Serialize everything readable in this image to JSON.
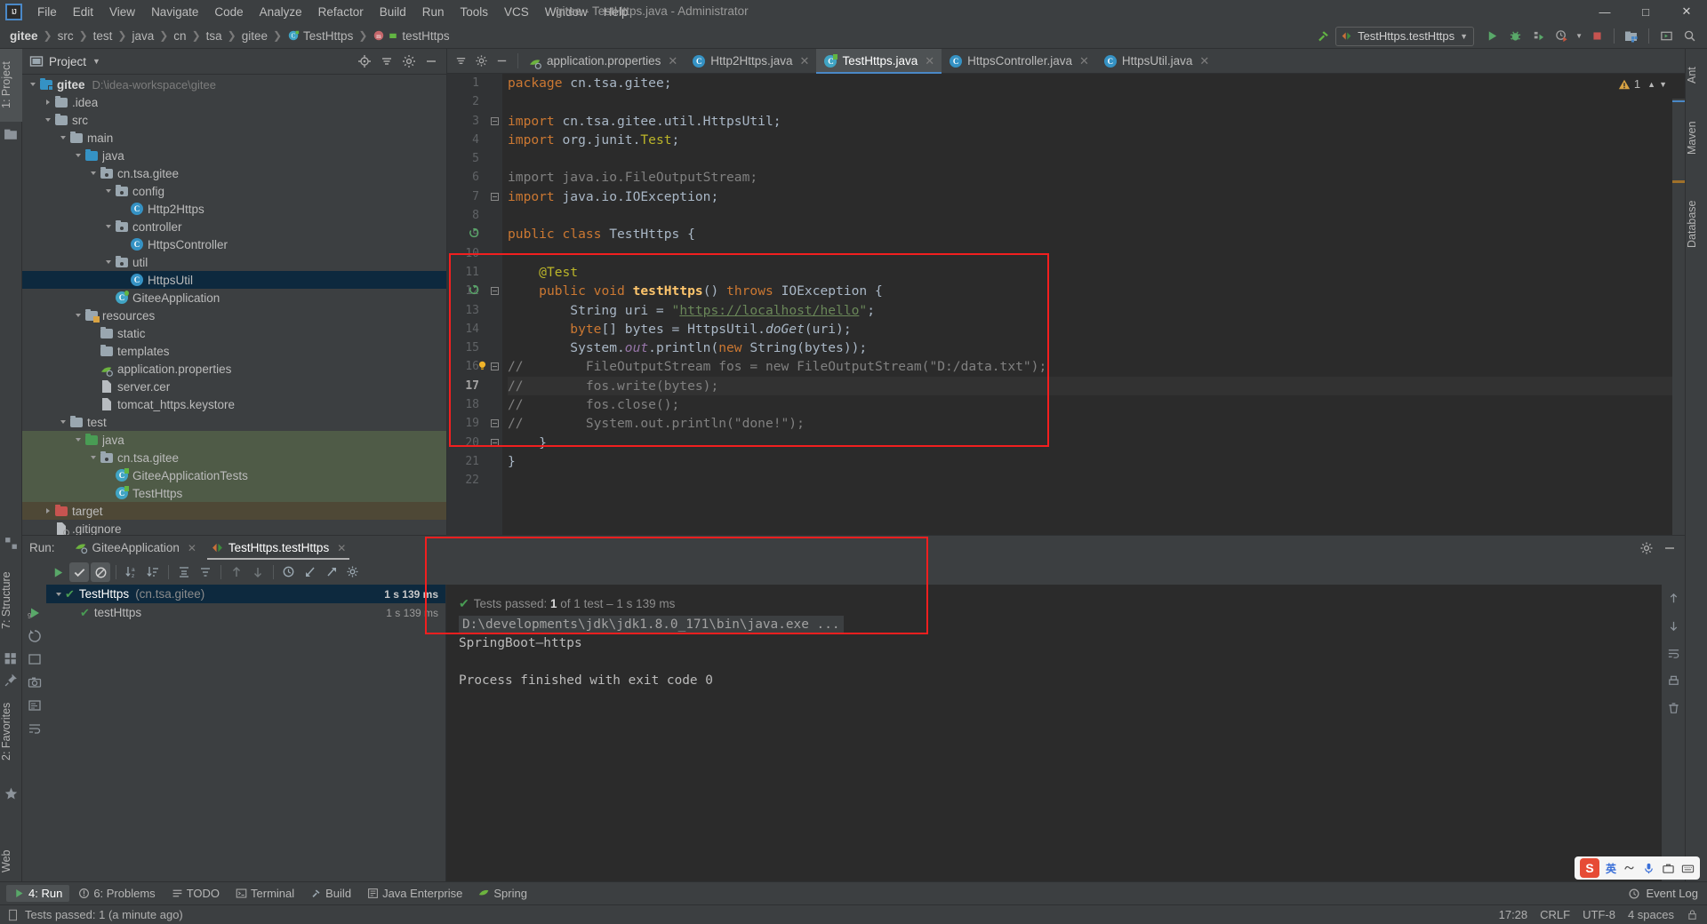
{
  "window": {
    "title": "gitee - TestHttps.java - Administrator",
    "minimize": "—",
    "maximize": "□",
    "close": "✕"
  },
  "menu": [
    "File",
    "Edit",
    "View",
    "Navigate",
    "Code",
    "Analyze",
    "Refactor",
    "Build",
    "Run",
    "Tools",
    "VCS",
    "Window",
    "Help"
  ],
  "breadcrumb": [
    "gitee",
    "src",
    "test",
    "java",
    "cn",
    "tsa",
    "gitee",
    "TestHttps",
    "testHttps"
  ],
  "toolbar": {
    "run_config": "TestHttps.testHttps",
    "icons": [
      "build-hammer-icon",
      "run-icon",
      "debug-icon",
      "run-coverage-icon",
      "profiler-icon",
      "stop-icon",
      "update-project-icon",
      "select-opened-file-icon",
      "search-everywhere-icon"
    ]
  },
  "project_panel": {
    "title": "Project",
    "header_icons": [
      "locate-icon",
      "collapse-all-icon",
      "settings-gear-icon",
      "hide-icon"
    ],
    "tree": [
      {
        "label": "gitee",
        "path": "D:\\idea-workspace\\gitee",
        "depth": 0,
        "arrow": "open",
        "icon": "module-folder",
        "bold": true
      },
      {
        "label": ".idea",
        "path": "",
        "depth": 1,
        "arrow": "closed",
        "icon": "folder"
      },
      {
        "label": "src",
        "path": "",
        "depth": 1,
        "arrow": "open",
        "icon": "folder"
      },
      {
        "label": "main",
        "path": "",
        "depth": 2,
        "arrow": "open",
        "icon": "folder"
      },
      {
        "label": "java",
        "path": "",
        "depth": 3,
        "arrow": "open",
        "icon": "source-folder-blue"
      },
      {
        "label": "cn.tsa.gitee",
        "path": "",
        "depth": 4,
        "arrow": "open",
        "icon": "package"
      },
      {
        "label": "config",
        "path": "",
        "depth": 5,
        "arrow": "open",
        "icon": "package"
      },
      {
        "label": "Http2Https",
        "path": "",
        "depth": 6,
        "arrow": "none",
        "icon": "class"
      },
      {
        "label": "controller",
        "path": "",
        "depth": 5,
        "arrow": "open",
        "icon": "package"
      },
      {
        "label": "HttpsController",
        "path": "",
        "depth": 6,
        "arrow": "none",
        "icon": "class"
      },
      {
        "label": "util",
        "path": "",
        "depth": 5,
        "arrow": "open",
        "icon": "package"
      },
      {
        "label": "HttpsUtil",
        "path": "",
        "depth": 6,
        "arrow": "none",
        "icon": "class",
        "selected": true
      },
      {
        "label": "GiteeApplication",
        "path": "",
        "depth": 5,
        "arrow": "none",
        "icon": "spring-class"
      },
      {
        "label": "resources",
        "path": "",
        "depth": 3,
        "arrow": "open",
        "icon": "resources-folder"
      },
      {
        "label": "static",
        "path": "",
        "depth": 4,
        "arrow": "none",
        "icon": "folder"
      },
      {
        "label": "templates",
        "path": "",
        "depth": 4,
        "arrow": "none",
        "icon": "folder"
      },
      {
        "label": "application.properties",
        "path": "",
        "depth": 4,
        "arrow": "none",
        "icon": "spring-file"
      },
      {
        "label": "server.cer",
        "path": "",
        "depth": 4,
        "arrow": "none",
        "icon": "file"
      },
      {
        "label": "tomcat_https.keystore",
        "path": "",
        "depth": 4,
        "arrow": "none",
        "icon": "file"
      },
      {
        "label": "test",
        "path": "",
        "depth": 2,
        "arrow": "open",
        "icon": "folder"
      },
      {
        "label": "java",
        "path": "",
        "depth": 3,
        "arrow": "open",
        "icon": "test-source-folder",
        "rowstyle": "testdir"
      },
      {
        "label": "cn.tsa.gitee",
        "path": "",
        "depth": 4,
        "arrow": "open",
        "icon": "package",
        "rowstyle": "testdir"
      },
      {
        "label": "GiteeApplicationTests",
        "path": "",
        "depth": 5,
        "arrow": "none",
        "icon": "test-class",
        "rowstyle": "testdir"
      },
      {
        "label": "TestHttps",
        "path": "",
        "depth": 5,
        "arrow": "none",
        "icon": "test-class",
        "rowstyle": "testdir"
      },
      {
        "label": "target",
        "path": "",
        "depth": 1,
        "arrow": "closed",
        "icon": "excluded-folder",
        "rowstyle": "targetdir"
      },
      {
        "label": ".gitignore",
        "path": "",
        "depth": 1,
        "arrow": "none",
        "icon": "gitignore-file"
      }
    ]
  },
  "editor": {
    "left_icons": [
      "collapse-all-icon",
      "settings-gear-icon",
      "hide-icon"
    ],
    "tabs": [
      {
        "label": "application.properties",
        "icon": "spring-file",
        "active": false
      },
      {
        "label": "Http2Https.java",
        "icon": "class",
        "active": false
      },
      {
        "label": "TestHttps.java",
        "icon": "test-class",
        "active": true
      },
      {
        "label": "HttpsController.java",
        "icon": "class",
        "active": false
      },
      {
        "label": "HttpsUtil.java",
        "icon": "class",
        "active": false
      }
    ],
    "warning_count": "1",
    "lines": [
      {
        "n": "1",
        "tokens": [
          [
            "kw",
            "package"
          ],
          [
            "id",
            " cn.tsa.gitee;"
          ]
        ]
      },
      {
        "n": "2",
        "tokens": []
      },
      {
        "n": "3",
        "fold": "start",
        "tokens": [
          [
            "kw",
            "import"
          ],
          [
            "id",
            " cn.tsa.gitee.util."
          ],
          [
            "id",
            "HttpsUtil"
          ],
          [
            "id",
            ";"
          ]
        ]
      },
      {
        "n": "4",
        "tokens": [
          [
            "kw",
            "import"
          ],
          [
            "id",
            " org.junit."
          ],
          [
            "anno",
            "Test"
          ],
          [
            "id",
            ";"
          ]
        ]
      },
      {
        "n": "5",
        "tokens": []
      },
      {
        "n": "6",
        "tokens": [
          [
            "cmt",
            "import java.io.FileOutputStream;"
          ]
        ]
      },
      {
        "n": "7",
        "fold": "end",
        "tokens": [
          [
            "kw",
            "import"
          ],
          [
            "id",
            " java.io.IOException;"
          ]
        ]
      },
      {
        "n": "8",
        "tokens": []
      },
      {
        "n": "9",
        "gmark": "run-test-gutter",
        "tokens": [
          [
            "kw",
            "public class "
          ],
          [
            "id",
            "TestHttps {"
          ]
        ]
      },
      {
        "n": "10",
        "tokens": []
      },
      {
        "n": "11",
        "tokens": [
          [
            "id",
            "    "
          ],
          [
            "anno",
            "@Test"
          ]
        ]
      },
      {
        "n": "12",
        "gmark": "run-test-gutter",
        "fold": "start",
        "tokens": [
          [
            "id",
            "    "
          ],
          [
            "kw",
            "public "
          ],
          [
            "kw",
            "void "
          ],
          [
            "dec",
            "testHttps"
          ],
          [
            "id",
            "() "
          ],
          [
            "kw",
            "throws "
          ],
          [
            "id",
            "IOException {"
          ]
        ]
      },
      {
        "n": "13",
        "tokens": [
          [
            "id",
            "        String uri = "
          ],
          [
            "str",
            "\""
          ],
          [
            "strlink",
            "https://localhost/hello"
          ],
          [
            "str",
            "\""
          ],
          [
            "id",
            ";"
          ]
        ]
      },
      {
        "n": "14",
        "tokens": [
          [
            "kw",
            "        byte"
          ],
          [
            "id",
            "[] bytes = HttpsUtil."
          ],
          [
            "mth",
            "doGet"
          ],
          [
            "id",
            "(uri);"
          ]
        ]
      },
      {
        "n": "15",
        "tokens": [
          [
            "id",
            "        System."
          ],
          [
            "fld",
            "out"
          ],
          [
            "id",
            ".println("
          ],
          [
            "kw",
            "new "
          ],
          [
            "id",
            "String(bytes));"
          ]
        ]
      },
      {
        "n": "16",
        "fold": "start",
        "gmark": "intention-bulb",
        "tokens": [
          [
            "cmt",
            "//        FileOutputStream fos = new FileOutputStream(\"D:/data.txt\");"
          ]
        ]
      },
      {
        "n": "17",
        "cur": true,
        "tokens": [
          [
            "cmt",
            "//        fos.write(bytes);"
          ]
        ]
      },
      {
        "n": "18",
        "tokens": [
          [
            "cmt",
            "//        fos.close();"
          ]
        ]
      },
      {
        "n": "19",
        "fold": "end",
        "tokens": [
          [
            "cmt",
            "//        System.out.println(\"done!\");"
          ]
        ]
      },
      {
        "n": "20",
        "fold": "end",
        "tokens": [
          [
            "id",
            "    }"
          ]
        ]
      },
      {
        "n": "21",
        "tokens": [
          [
            "id",
            "}"
          ]
        ]
      },
      {
        "n": "22",
        "tokens": []
      }
    ]
  },
  "run_panel": {
    "label": "Run:",
    "tabs": [
      {
        "label": "GiteeApplication",
        "icon": "spring-run",
        "active": false
      },
      {
        "label": "TestHttps.testHttps",
        "icon": "junit-run",
        "active": true
      }
    ],
    "header_icons": [
      "settings-gear-icon",
      "hide-icon"
    ],
    "toolbar_icons": [
      "rerun-icon",
      "show-passed-icon",
      "show-ignored-icon",
      "sort-alphabetically-icon",
      "sort-duration-icon",
      "expand-all-icon",
      "collapse-all-icon",
      "prev-test-icon",
      "next-test-icon",
      "history-icon",
      "import-tests-icon",
      "export-tests-icon",
      "test-settings-icon"
    ],
    "left_icons": [
      "rerun-icon-left",
      "console-icon",
      "restart-icon",
      "dump-icon",
      "camera-icon",
      "print-icon",
      "soft-wrap-icon"
    ],
    "tree": [
      {
        "label": "TestHttps",
        "pkg": "(cn.tsa.gitee)",
        "duration": "1 s 139 ms",
        "depth": 0,
        "arrow": "open",
        "selected": true
      },
      {
        "label": "testHttps",
        "pkg": "",
        "duration": "1 s 139 ms",
        "depth": 1,
        "arrow": "none",
        "selected": false
      }
    ],
    "console": {
      "summary_prefix": "Tests passed: ",
      "summary_count": "1",
      "summary_suffix": " of 1 test – 1 s 139 ms",
      "command": "D:\\developments\\jdk\\jdk1.8.0_171\\bin\\java.exe ...",
      "output": "SpringBoot—https",
      "exit": "Process finished with exit code 0"
    },
    "console_right_icons": [
      "scroll-up-icon",
      "scroll-down-icon",
      "soft-wrap-icon",
      "print-icon",
      "clear-all-icon"
    ]
  },
  "left_strips": {
    "top": [
      "1: Project"
    ],
    "bottom": [
      "7: Structure",
      "2: Favorites",
      "Web"
    ]
  },
  "right_strips": [
    "Ant",
    "Maven",
    "Database"
  ],
  "tool_window_bar": {
    "buttons": [
      {
        "label": "4: Run",
        "icon": "run-icon",
        "active": true
      },
      {
        "label": "6: Problems",
        "icon": "problems-icon",
        "active": false
      },
      {
        "label": "TODO",
        "icon": "todo-icon",
        "active": false
      },
      {
        "label": "Terminal",
        "icon": "terminal-icon",
        "active": false
      },
      {
        "label": "Build",
        "icon": "build-hammer-icon",
        "active": false
      },
      {
        "label": "Java Enterprise",
        "icon": "java-ee-icon",
        "active": false
      },
      {
        "label": "Spring",
        "icon": "spring-leaf-icon",
        "active": false
      }
    ],
    "event_log": "Event Log"
  },
  "status_bar": {
    "message": "Tests passed: 1 (a minute ago)",
    "time": "17:28",
    "line_sep": "CRLF",
    "encoding": "UTF-8",
    "indent": "4 spaces"
  },
  "ime": {
    "lang": "英",
    "logo": "S"
  },
  "colors": {
    "accent_blue": "#4a88c7",
    "selection": "#0d293e",
    "test_green": "#499c54",
    "annotation": "#bbb529",
    "keyword": "#cc7832",
    "string": "#6a8759",
    "comment": "#808080",
    "redbox": "#f21f1f"
  }
}
